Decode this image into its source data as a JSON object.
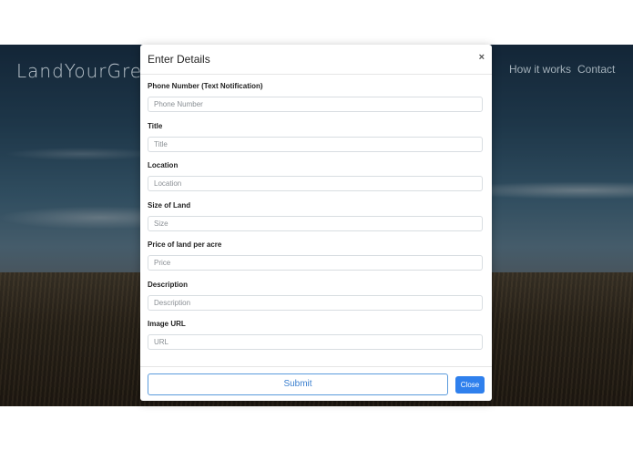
{
  "page": {
    "brand": "LandYourGree",
    "nav": [
      "How it works",
      "Contact"
    ]
  },
  "modal": {
    "title": "Enter Details",
    "close_icon": "×",
    "fields": [
      {
        "label": "Phone Number (Text Notification)",
        "placeholder": "Phone Number"
      },
      {
        "label": "Title",
        "placeholder": "Title"
      },
      {
        "label": "Location",
        "placeholder": "Location"
      },
      {
        "label": "Size of Land",
        "placeholder": "Size"
      },
      {
        "label": "Price of land per acre",
        "placeholder": "Price"
      },
      {
        "label": "Description",
        "placeholder": "Description"
      },
      {
        "label": "Image URL",
        "placeholder": "URL"
      }
    ],
    "submit_label": "Submit",
    "close_label": "Close"
  },
  "colors": {
    "accent": "#2f80ed",
    "submit_border": "#5b9bdc"
  }
}
